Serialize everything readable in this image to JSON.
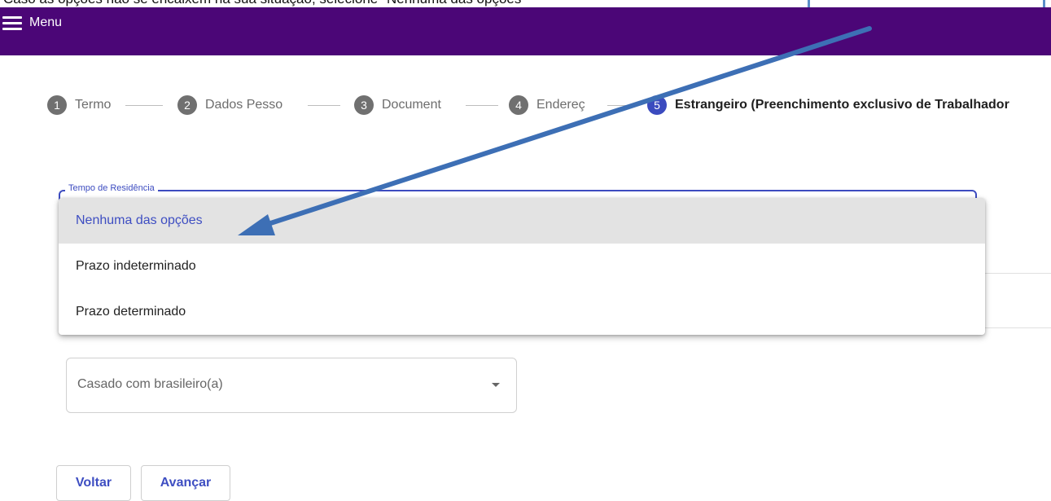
{
  "header": {
    "menu_label": "Menu",
    "bar_color": "#4b0677"
  },
  "annotation": {
    "caption": "Caso as opções não se encaixem na sua situação, selecione \"Nenhuma das opções\"",
    "arrow_color": "#3d6fb5"
  },
  "stepper": {
    "steps": [
      {
        "number": "1",
        "label": "Termo"
      },
      {
        "number": "2",
        "label": "Dados Pesso"
      },
      {
        "number": "3",
        "label": "Document"
      },
      {
        "number": "4",
        "label": "Endereç"
      },
      {
        "number": "5",
        "label": "Estrangeiro (Preenchimento exclusivo de Trabalhador"
      }
    ],
    "active_step": 5,
    "active_color": "#3b4bbf"
  },
  "residence_field": {
    "label": "Tempo de Residência",
    "options": [
      {
        "label": "Nenhuma das opções",
        "selected": true
      },
      {
        "label": "Prazo indeterminado",
        "selected": false
      },
      {
        "label": "Prazo determinado",
        "selected": false
      }
    ]
  },
  "married_field": {
    "value": "Casado com brasileiro(a)"
  },
  "actions": {
    "back_label": "Voltar",
    "next_label": "Avançar",
    "accent_color": "#3e4ec2"
  }
}
